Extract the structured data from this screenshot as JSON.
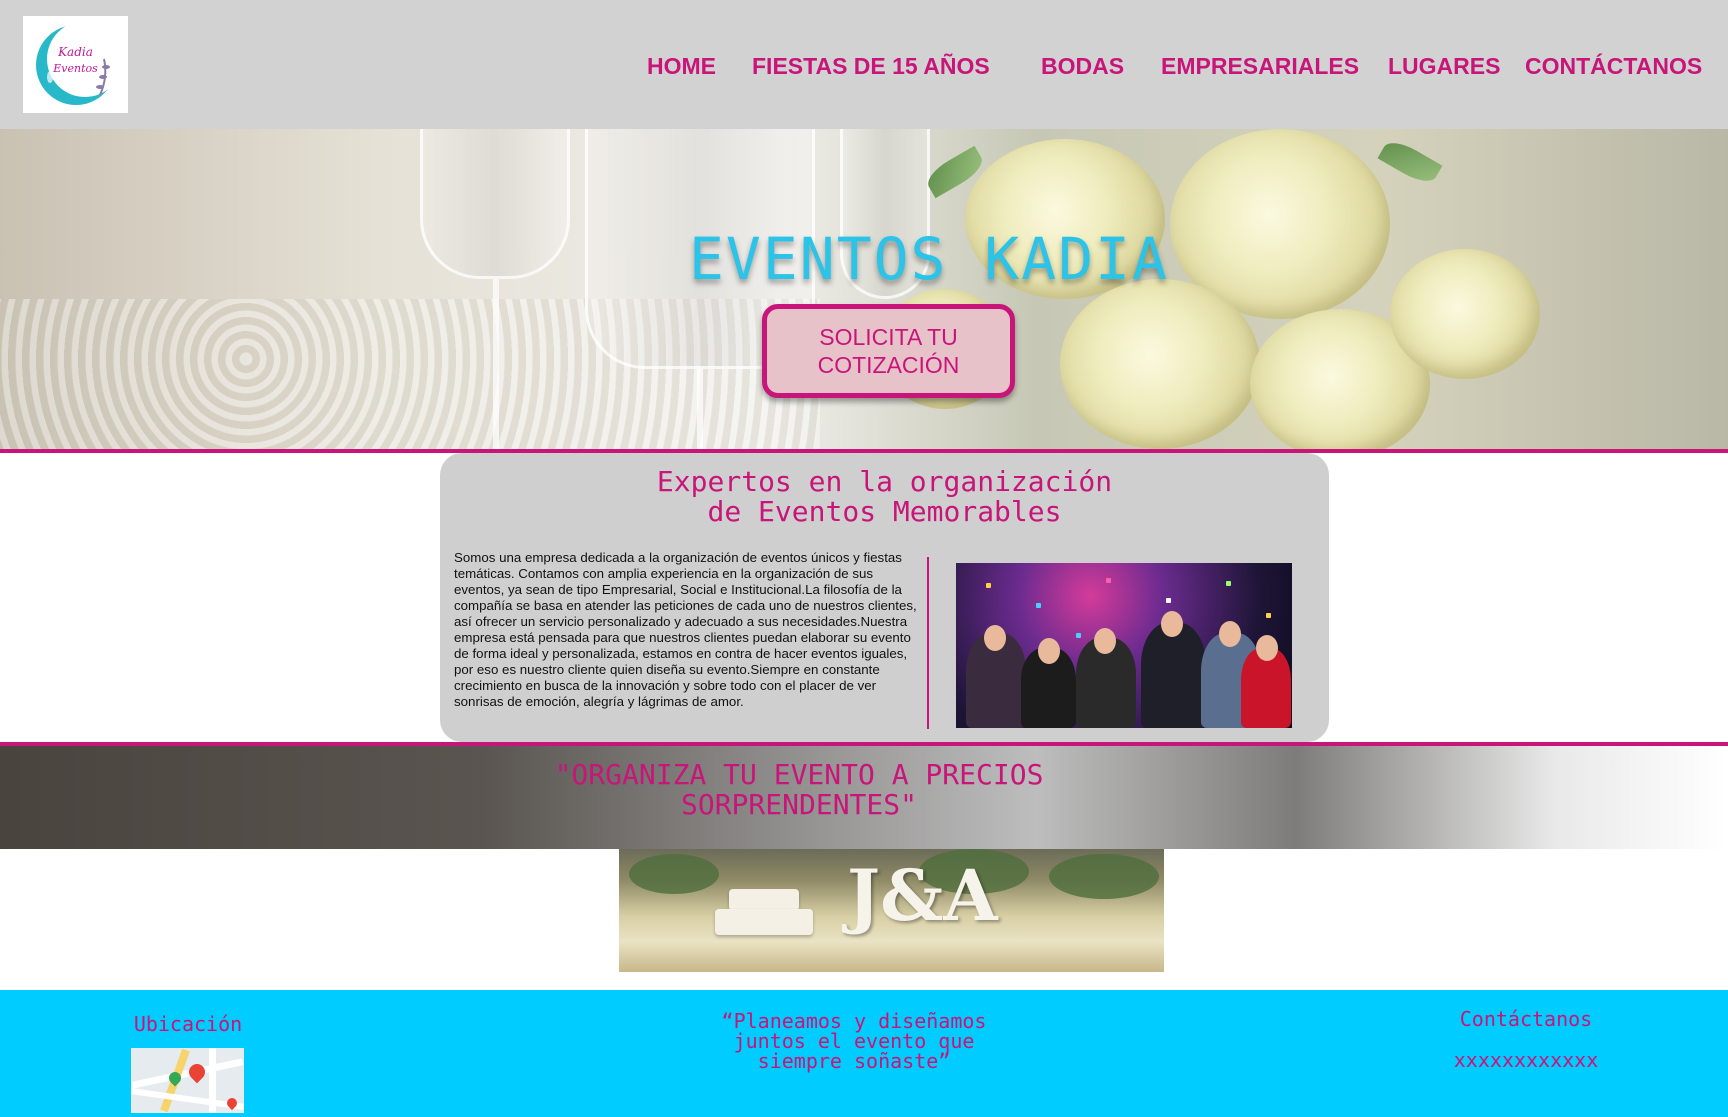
{
  "logo": {
    "line1": "Kadia",
    "line2": "Eventos"
  },
  "nav": {
    "home": "HOME",
    "quince": "FIESTAS DE 15 AÑOS",
    "bodas": "BODAS",
    "empresariales": "EMPRESARIALES",
    "lugares": "LUGARES",
    "contacto": "CONTÁCTANOS"
  },
  "hero": {
    "title": "EVENTOS KADIA",
    "button": "SOLICITA TU\nCOTIZACIÓN"
  },
  "about": {
    "title": "Expertos en la organización\nde Eventos Memorables",
    "text": "Somos una empresa dedicada a la organización de eventos únicos y fiestas temáticas. Contamos con amplia experiencia en la organización de sus eventos, ya sean de tipo Empresarial, Social e Institucional.La filosofía de la compañía se basa en atender las peticiones de cada uno de nuestros clientes, así ofrecer un servicio personalizado y adecuado a sus necesidades.Nuestra empresa está pensada para que nuestros clientes puedan elaborar su evento de forma ideal y personalizada, estamos en contra de hacer eventos iguales, por eso es nuestro cliente quien diseña su evento.Siempre en constante crecimiento en busca de la innovación y sobre todo con el placer de ver sonrisas de emoción, alegría y lágrimas de amor."
  },
  "banner": {
    "text": "\"ORGANIZA TU EVENTO A PRECIOS\nSORPRENDENTES\""
  },
  "wedding": {
    "letters": "J&A"
  },
  "footer": {
    "location_label": "Ubicación",
    "slogan": "“Planeamos y diseñamos\njuntos el evento que\nsiempre soñaste”",
    "contact_label": "Contáctanos",
    "contact_value": "xxxxxxxxxxxx"
  },
  "colors": {
    "brand_pink": "#c8157a",
    "header_gray": "#d2d2d2",
    "footer_cyan": "#00ccff",
    "title_cyan": "#2bc3e8"
  }
}
